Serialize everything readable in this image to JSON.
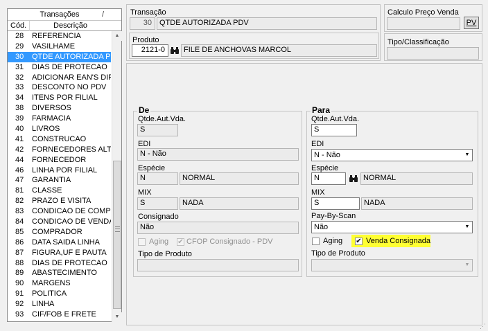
{
  "transactions_list": {
    "title": "Transações",
    "title_marker": "/",
    "columns": {
      "code": "Cód.",
      "description": "Descrição"
    },
    "selected_code": "30",
    "rows": [
      {
        "code": "28",
        "description": "REFERENCIA"
      },
      {
        "code": "29",
        "description": "VASILHAME"
      },
      {
        "code": "30",
        "description": "QTDE AUTORIZADA PDV"
      },
      {
        "code": "31",
        "description": "DIAS DE PROTECAO"
      },
      {
        "code": "32",
        "description": "ADICIONAR EAN'S DIFEREN"
      },
      {
        "code": "33",
        "description": "DESCONTO NO PDV"
      },
      {
        "code": "34",
        "description": "ITENS POR FILIAL"
      },
      {
        "code": "38",
        "description": "DIVERSOS"
      },
      {
        "code": "39",
        "description": "FARMACIA"
      },
      {
        "code": "40",
        "description": "LIVROS"
      },
      {
        "code": "41",
        "description": "CONSTRUCAO"
      },
      {
        "code": "42",
        "description": "FORNECEDORES ALTERNA"
      },
      {
        "code": "44",
        "description": "FORNECEDOR"
      },
      {
        "code": "46",
        "description": "LINHA POR FILIAL"
      },
      {
        "code": "47",
        "description": "GARANTIA"
      },
      {
        "code": "81",
        "description": "CLASSE"
      },
      {
        "code": "82",
        "description": "PRAZO E VISITA"
      },
      {
        "code": "83",
        "description": "CONDICAO DE COMPRA"
      },
      {
        "code": "84",
        "description": "CONDICAO DE VENDA"
      },
      {
        "code": "85",
        "description": "COMPRADOR"
      },
      {
        "code": "86",
        "description": "DATA SAIDA LINHA"
      },
      {
        "code": "87",
        "description": "FIGURA,UF E PAUTA"
      },
      {
        "code": "88",
        "description": "DIAS DE PROTECAO"
      },
      {
        "code": "89",
        "description": "ABASTECIMENTO"
      },
      {
        "code": "90",
        "description": "MARGENS"
      },
      {
        "code": "91",
        "description": "POLITICA"
      },
      {
        "code": "92",
        "description": "LINHA"
      },
      {
        "code": "93",
        "description": "CIF/FOB E FRETE"
      }
    ]
  },
  "transacao": {
    "label": "Transação",
    "code": "30",
    "name": "QTDE AUTORIZADA PDV"
  },
  "produto": {
    "label": "Produto",
    "code": "2121-0",
    "name": "FILE DE ANCHOVAS MARCOL",
    "search_icon": "binoculars-icon"
  },
  "calculo": {
    "label": "Calculo Preço Venda",
    "value": "",
    "button": "PV"
  },
  "tipo_classificacao": {
    "label": "Tipo/Classificação",
    "value": ""
  },
  "de": {
    "title": "De",
    "qtde_label": "Qtde.Aut.Vda.",
    "qtde_value": "S",
    "edi_label": "EDI",
    "edi_value": "N - Não",
    "especie_label": "Espécie",
    "especie_code": "N",
    "especie_name": "NORMAL",
    "mix_label": "MIX",
    "mix_code": "S",
    "mix_name": "NADA",
    "consignado_label": "Consignado",
    "consignado_value": "Não",
    "aging_label": "Aging",
    "aging_checked": false,
    "cfop_label": "CFOP Consignado - PDV",
    "cfop_checked": true,
    "tipo_produto_label": "Tipo de Produto",
    "tipo_produto_value": ""
  },
  "para": {
    "title": "Para",
    "qtde_label": "Qtde.Aut.Vda.",
    "qtde_value": "S",
    "edi_label": "EDI",
    "edi_value": "N - Não",
    "especie_label": "Espécie",
    "especie_code": "N",
    "especie_name": "NORMAL",
    "mix_label": "MIX",
    "mix_code": "S",
    "mix_name": "NADA",
    "pay_by_scan_label": "Pay-By-Scan",
    "pay_by_scan_value": "Não",
    "aging_label": "Aging",
    "aging_checked": false,
    "venda_consignada_label": "Venda Consignada",
    "venda_consignada_checked": true,
    "tipo_produto_label": "Tipo de Produto",
    "tipo_produto_value": ""
  },
  "colors": {
    "selection": "#3399ff",
    "highlight": "#ffff33"
  }
}
